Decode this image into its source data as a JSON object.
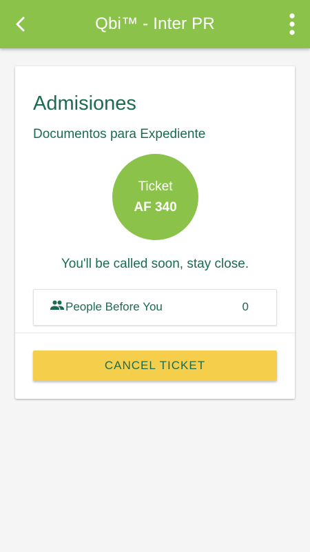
{
  "appbar": {
    "title": "Qbi™ - Inter PR",
    "back_icon": "arrow-back-icon",
    "menu_icon": "more-vert-icon"
  },
  "card": {
    "title": "Admisiones",
    "subtitle": "Documentos para Expediente",
    "ticket": {
      "label": "Ticket",
      "number": "AF 340"
    },
    "status_message": "You'll be called soon, stay close.",
    "people_before": {
      "icon": "people-icon",
      "label": "People Before You",
      "count": "0"
    },
    "cancel_label": "CANCEL TICKET"
  },
  "colors": {
    "primary": "#8bc34a",
    "text_accent": "#1c6b4f",
    "cancel_button": "#f5cf4c",
    "background": "#f4f5f4"
  }
}
